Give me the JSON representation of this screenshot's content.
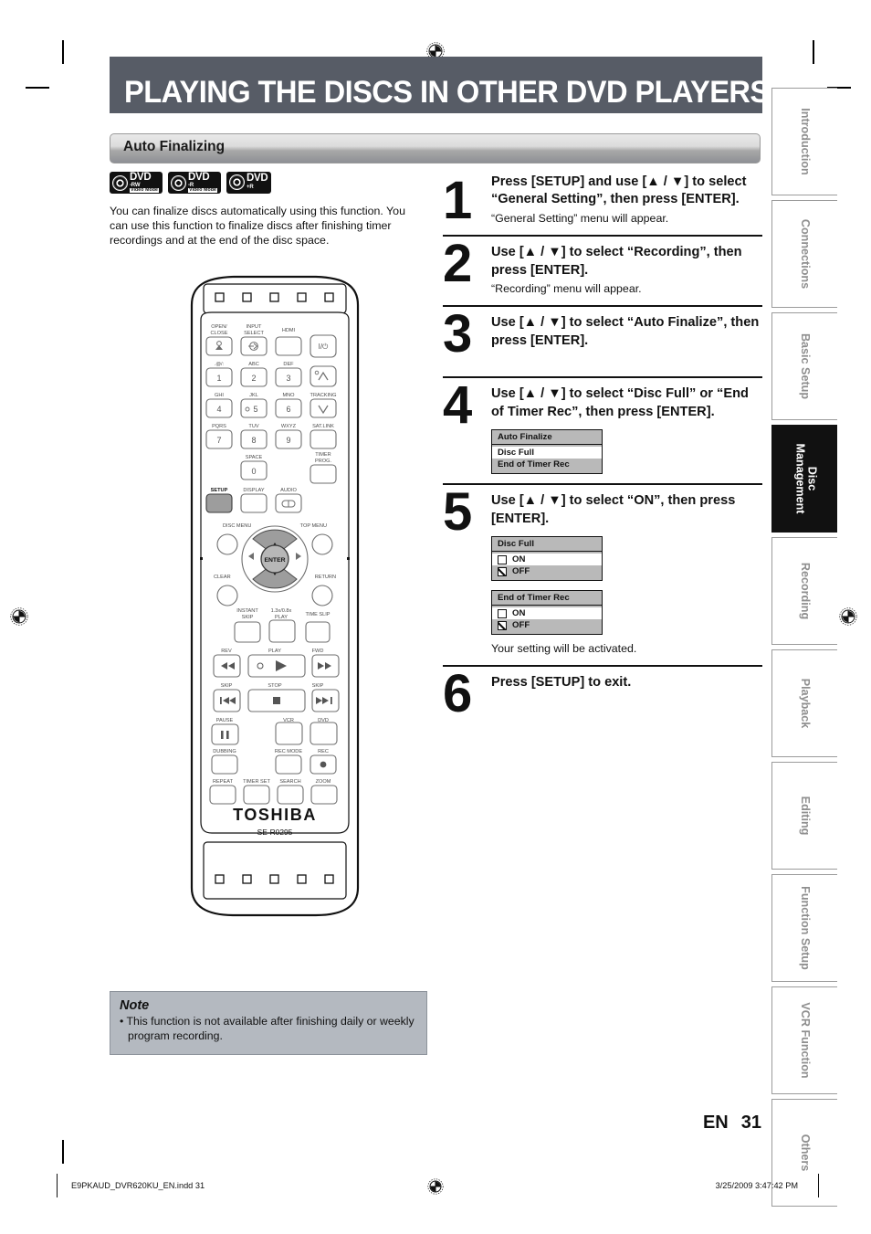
{
  "header": {
    "title": "PLAYING THE DISCS IN OTHER DVD PLAYERS",
    "subtitle": "Auto Finalizing",
    "bar_color": "#575c66"
  },
  "left": {
    "logos": [
      {
        "name": "dvd-rw-video-mode-logo",
        "main": "DVD",
        "format": "-RW",
        "mode": "Video Mode"
      },
      {
        "name": "dvd-r-video-mode-logo",
        "main": "DVD",
        "format": "-R",
        "mode": "Video Mode"
      },
      {
        "name": "dvd-plus-r-logo",
        "main": "DVD",
        "format": "+R",
        "mode": ""
      }
    ],
    "intro": "You can finalize discs automatically using this function. You can use this function to finalize discs after finishing timer recordings and at the end of the disc space."
  },
  "note": {
    "title": "Note",
    "items": [
      "• This function is not available after finishing daily or weekly program recording."
    ]
  },
  "steps": [
    {
      "number": "1",
      "head": "Press [SETUP] and use [▲ / ▼] to select “General Setting”, then press [ENTER].",
      "sub": "“General Setting” menu will appear."
    },
    {
      "number": "2",
      "head": "Use [▲ / ▼] to select “Recording”, then press [ENTER].",
      "sub": "“Recording” menu will appear."
    },
    {
      "number": "3",
      "head": "Use [▲ / ▼] to select “Auto Finalize”, then press [ENTER].",
      "sub": ""
    },
    {
      "number": "4",
      "head": "Use [▲ / ▼] to select “Disc Full” or “End of Timer Rec”, then press [ENTER].",
      "sub": ""
    },
    {
      "number": "5",
      "head": "Use [▲ / ▼] to select “ON”, then press [ENTER].",
      "sub": ""
    },
    {
      "number": "6",
      "head": "Press [SETUP] to exit.",
      "sub": ""
    }
  ],
  "osd": {
    "auto_finalize": {
      "title": "Auto Finalize",
      "rows": [
        {
          "label": "Disc Full",
          "selected": true
        },
        {
          "label": "End of Timer Rec",
          "selected": false
        }
      ]
    },
    "disc_full": {
      "title": "Disc Full",
      "rows": [
        {
          "label": "ON",
          "checked": false,
          "selected": true
        },
        {
          "label": "OFF",
          "checked": true,
          "selected": false
        }
      ]
    },
    "end_of_timer_rec": {
      "title": "End of Timer Rec",
      "rows": [
        {
          "label": "ON",
          "checked": false,
          "selected": true
        },
        {
          "label": "OFF",
          "checked": true,
          "selected": false
        }
      ]
    },
    "after_note": "Your setting will be activated."
  },
  "remote": {
    "brand": "TOSHIBA",
    "model": "SE-R0295",
    "labels": {
      "open_close": "OPEN/\nCLOSE",
      "input_select": "INPUT\nSELECT",
      "hdmi": "HDMI",
      "power": "I/⏻",
      "key1_alt": ".@/:",
      "key2_alt": "ABC",
      "key3_alt": "DEF",
      "key4_alt": "GHI",
      "key5_alt": "JKL",
      "key6_alt": "MNO",
      "key7_alt": "PQRS",
      "key8_alt": "TUV",
      "key9_alt": "WXYZ",
      "key0_alt": "SPACE",
      "tracking": "TRACKING",
      "sat_link": "SAT.LINK",
      "timer_prog": "TIMER\nPROG.",
      "setup": "SETUP",
      "display": "DISPLAY",
      "audio": "AUDIO",
      "disc_menu": "DISC MENU",
      "top_menu": "TOP MENU",
      "clear": "CLEAR",
      "return": "RETURN",
      "enter": "ENTER",
      "instant_skip": "INSTANT\nSKIP",
      "speed_play": "1.3x/0.8x\nPLAY",
      "time_slip": "TIME SLIP",
      "rev": "REV",
      "play": "PLAY",
      "fwd": "FWD",
      "skip_back": "SKIP",
      "stop": "STOP",
      "skip_fwd": "SKIP",
      "pause": "PAUSE",
      "vcr": "VCR",
      "dvd": "DVD",
      "dubbing": "DUBBING",
      "rec_mode": "REC MODE",
      "rec": "REC",
      "repeat": "REPEAT",
      "timer_set": "TIMER SET",
      "search": "SEARCH",
      "zoom": "ZOOM"
    },
    "digits": [
      "1",
      "2",
      "3",
      "4",
      "5",
      "6",
      "7",
      "8",
      "9",
      "0"
    ]
  },
  "rail": {
    "tabs": [
      {
        "label": "Introduction",
        "active": false
      },
      {
        "label": "Connections",
        "active": false
      },
      {
        "label": "Basic Setup",
        "active": false
      },
      {
        "label": "Disc Management",
        "active": true
      },
      {
        "label": "Recording",
        "active": false
      },
      {
        "label": "Playback",
        "active": false
      },
      {
        "label": "Editing",
        "active": false
      },
      {
        "label": "Function Setup",
        "active": false
      },
      {
        "label": "VCR Function",
        "active": false
      },
      {
        "label": "Others",
        "active": false
      }
    ]
  },
  "footer": {
    "lang": "EN",
    "page": "31",
    "file": "E9PKAUD_DVR620KU_EN.indd   31",
    "timestamp": "3/25/2009   3:47:42 PM"
  }
}
